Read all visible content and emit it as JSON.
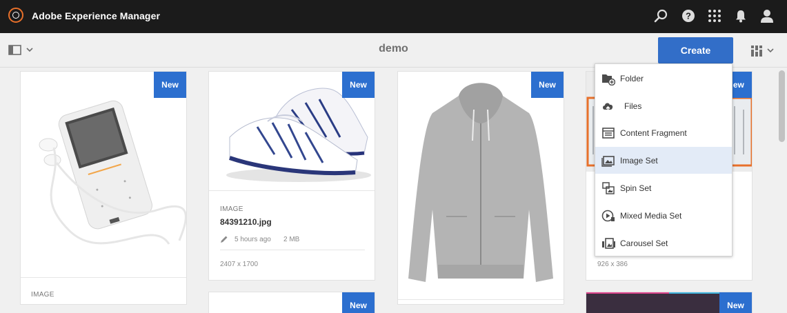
{
  "app": {
    "title": "Adobe Experience Manager"
  },
  "header_icons": [
    "search-icon",
    "help-icon",
    "apps-grid-icon",
    "bell-icon",
    "user-icon"
  ],
  "actionbar": {
    "title": "demo",
    "create_label": "Create"
  },
  "badge_label": "New",
  "cards": [
    {
      "type": "IMAGE",
      "image": "mp3-player"
    },
    {
      "type": "IMAGE",
      "name": "84391210.jpg",
      "modified": "5 hours ago",
      "size": "2 MB",
      "dimensions": "2407 x 1700",
      "image": "sneakers"
    },
    {
      "type": "",
      "image": "hoodie"
    },
    {
      "dimensions": "926 x 386",
      "image": "winter-forest"
    }
  ],
  "create_menu": [
    {
      "label": "Folder",
      "icon": "folder-add-icon"
    },
    {
      "label": "Files",
      "icon": "cloud-upload-icon"
    },
    {
      "label": "Content Fragment",
      "icon": "content-fragment-icon"
    },
    {
      "label": "Image Set",
      "icon": "image-set-icon",
      "active": true
    },
    {
      "label": "Spin Set",
      "icon": "spin-set-icon"
    },
    {
      "label": "Mixed Media Set",
      "icon": "mixed-media-set-icon"
    },
    {
      "label": "Carousel Set",
      "icon": "carousel-set-icon"
    }
  ],
  "colors": {
    "header_bg": "#1b1b1b",
    "accent": "#326ec8",
    "badge": "#2c6fcf",
    "logo": "#e8702a",
    "menu_active": "#e3ebf7"
  }
}
